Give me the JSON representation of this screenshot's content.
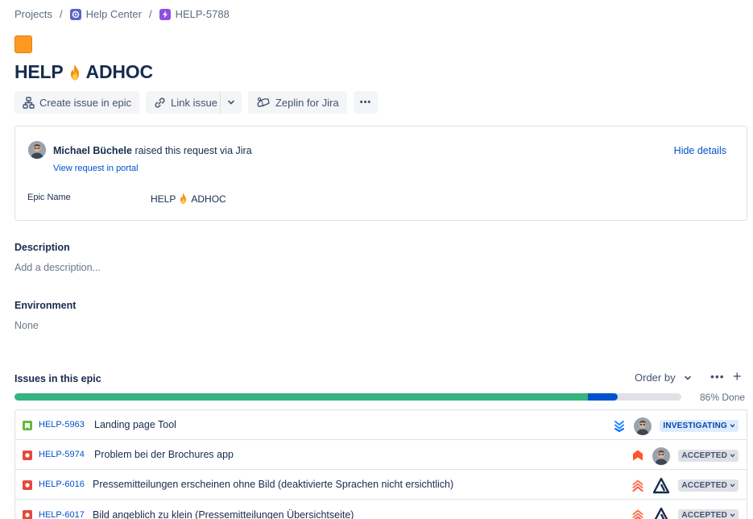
{
  "breadcrumb": {
    "projects": "Projects",
    "project": "Help Center",
    "issue_key": "HELP-5788",
    "separator": "/"
  },
  "epic": {
    "color": "#ff991f",
    "title_left": "HELP",
    "title_right": "ADHOC"
  },
  "toolbar": {
    "create_issue": "Create issue in epic",
    "link_issue": "Link issue",
    "zeplin": "Zeplin for Jira",
    "more": "•••"
  },
  "request": {
    "reporter": "Michael Büchele",
    "raised_text": "raised this request via",
    "channel": "Jira",
    "portal_link": "View request in portal",
    "hide_details": "Hide details",
    "epic_name_label": "Epic Name",
    "epic_name_left": "HELP",
    "epic_name_right": "ADHOC"
  },
  "description": {
    "heading": "Description",
    "placeholder": "Add a description..."
  },
  "environment": {
    "heading": "Environment",
    "value": "None"
  },
  "issues": {
    "heading": "Issues in this epic",
    "order_by": "Order by",
    "more": "•••",
    "add": "+",
    "progress_done_pct": 86,
    "progress_inprogress_pct": 4.5,
    "progress_label": "86% Done",
    "rows": [
      {
        "type": "story",
        "key": "HELP-5963",
        "summary": "Landing page Tool",
        "priority": "lowest",
        "assignee": "photo",
        "status": "INVESTIGATING",
        "status_style": "blue"
      },
      {
        "type": "bug",
        "key": "HELP-5974",
        "summary": "Problem bei der Brochures app",
        "priority": "highest",
        "assignee": "photo",
        "status": "ACCEPTED",
        "status_style": "grey"
      },
      {
        "type": "bug",
        "key": "HELP-6016",
        "summary": "Pressemitteilungen erscheinen ohne Bild (deaktivierte Sprachen nicht ersichtlich)",
        "priority": "high",
        "assignee": "logo",
        "status": "ACCEPTED",
        "status_style": "grey"
      },
      {
        "type": "bug",
        "key": "HELP-6017",
        "summary": "Bild angeblich zu klein (Pressemitteilungen Übersichtseite)",
        "priority": "high",
        "assignee": "logo",
        "status": "ACCEPTED",
        "status_style": "grey"
      }
    ]
  }
}
